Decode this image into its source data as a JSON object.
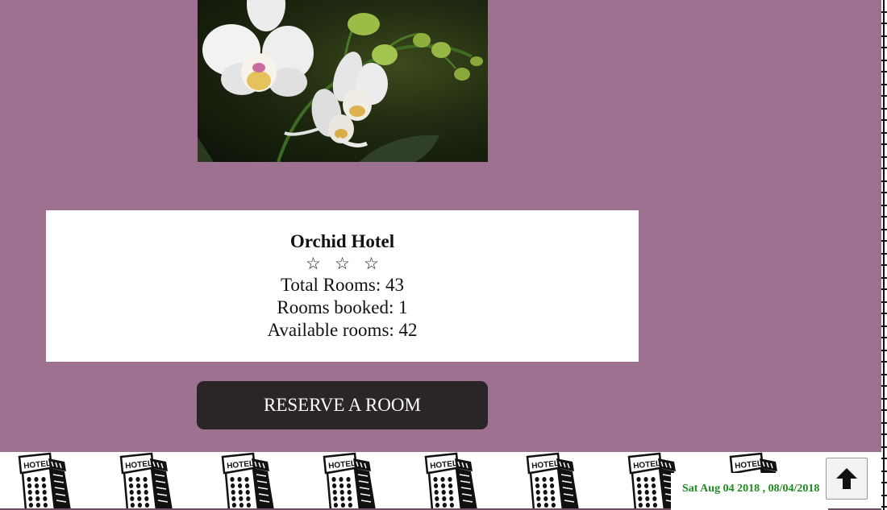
{
  "hotel": {
    "name": "Orchid Hotel",
    "stars": "☆ ☆ ☆",
    "total_rooms": "Total Rooms: 43",
    "rooms_booked": "Rooms booked: 1",
    "available_rooms": "Available rooms: 42"
  },
  "actions": {
    "reserve_label": "RESERVE A ROOM"
  },
  "footer": {
    "date_text": "Sat Aug 04 2018 , 08/04/2018",
    "building_sign": "HOTEL",
    "scroll_top_icon": "arrow-up-icon"
  },
  "colors": {
    "page_background": "#9e7190",
    "button_background": "#2a2527",
    "date_text": "#1e8a1e"
  }
}
